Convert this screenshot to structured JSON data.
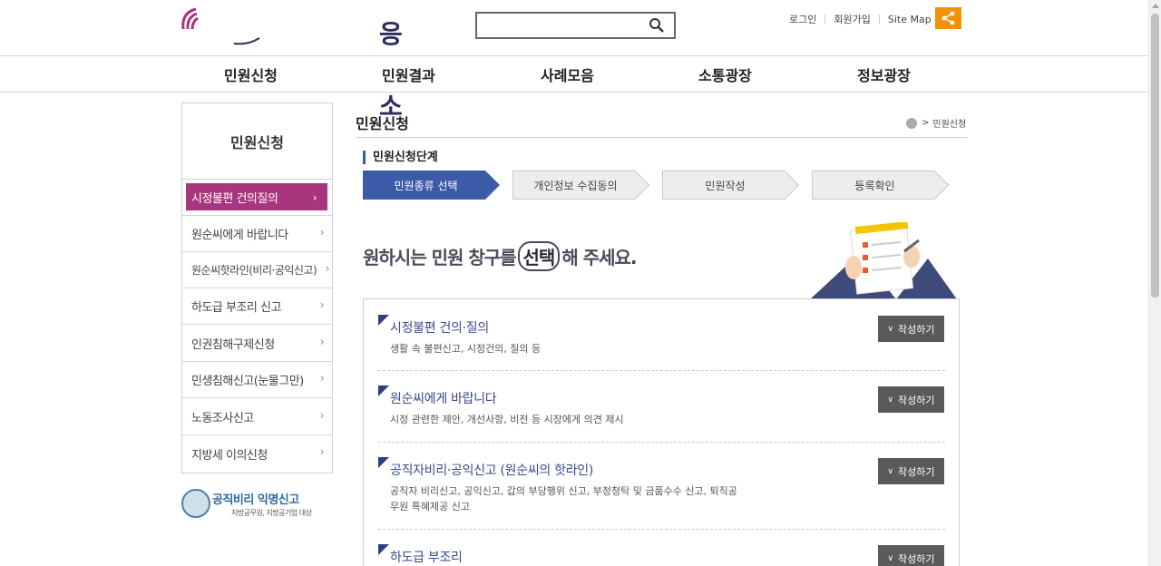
{
  "header": {
    "logo_text": "응답소",
    "search": {
      "value": "",
      "placeholder": ""
    },
    "util_links": [
      "로그인",
      "회원가입",
      "Site Map"
    ]
  },
  "gnb": [
    "민원신청",
    "민원결과",
    "사례모음",
    "소통광장",
    "정보광장"
  ],
  "sidebar": {
    "title": "민원신청",
    "items": [
      {
        "label": "시정불편 건의질의",
        "active": true
      },
      {
        "label": "원순씨에게 바랍니다",
        "active": false
      },
      {
        "label": "원순씨핫라인(비리·공익신고)",
        "active": false
      },
      {
        "label": "하도급 부조리 신고",
        "active": false
      },
      {
        "label": "인권침해구제신청",
        "active": false
      },
      {
        "label": "민생침해신고(눈물그만)",
        "active": false
      },
      {
        "label": "노동조사신고",
        "active": false
      },
      {
        "label": "지방세 이의신청",
        "active": false
      }
    ],
    "arrow": "›",
    "anon_report": {
      "title": "공직비리 익명신고",
      "subtitle": "지방공무원, 지방공기업 대상"
    }
  },
  "content": {
    "title": "민원신청",
    "breadcrumb": {
      "sep": ">",
      "current": "민원신청"
    },
    "step_heading": "민원신청단계",
    "steps": [
      {
        "label": "민원종류 선택",
        "active": true
      },
      {
        "label": "개인정보 수집동의",
        "active": false
      },
      {
        "label": "민원작성",
        "active": false
      },
      {
        "label": "등록확인",
        "active": false
      }
    ],
    "banner": {
      "before": "원하시는 민원 창구를 ",
      "highlight": "선택",
      "after": "해 주세요."
    },
    "write_label": "작성하기",
    "write_chevron": "∨",
    "items": [
      {
        "title": "시정불편 건의·질의",
        "desc": "생활 속 불편신고, 시정건의, 질의 등"
      },
      {
        "title": "원순씨에게 바랍니다",
        "desc": "시정 관련한 제안, 개선사항, 비전 등 시장에게 의견 제시"
      },
      {
        "title": "공직자비리·공익신고 (원순씨의 핫라인)",
        "desc": "공직자 비리신고, 공익신고, 갑의 부당행위 신고, 부정청탁 및 금품수수 신고, 퇴직공무원 특혜제공 신고"
      },
      {
        "title": "하도급 부조리",
        "desc": ""
      }
    ]
  },
  "colors": {
    "accent": "#a8367e",
    "step_active": "#3b5aa8",
    "share": "#f39200",
    "button": "#5a5a5a"
  }
}
